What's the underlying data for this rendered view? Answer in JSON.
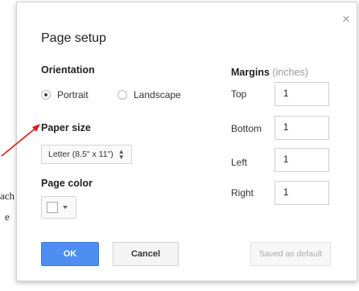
{
  "dialog": {
    "title": "Page setup",
    "close_glyph": "×"
  },
  "orientation": {
    "label": "Orientation",
    "options": [
      {
        "label": "Portrait",
        "selected": true
      },
      {
        "label": "Landscape",
        "selected": false
      }
    ]
  },
  "paper_size": {
    "label": "Paper size",
    "value": "Letter (8.5\" x 11\")"
  },
  "page_color": {
    "label": "Page color",
    "value": "#ffffff"
  },
  "margins": {
    "label": "Margins",
    "unit": "(inches)",
    "fields": [
      {
        "label": "Top",
        "value": "1"
      },
      {
        "label": "Bottom",
        "value": "1"
      },
      {
        "label": "Left",
        "value": "1"
      },
      {
        "label": "Right",
        "value": "1"
      }
    ]
  },
  "buttons": {
    "ok": "OK",
    "cancel": "Cancel",
    "default": "Saved as default"
  },
  "background": {
    "fragment_1": "ach",
    "fragment_2": "e"
  },
  "colors": {
    "accent": "#4d8ef0",
    "annotation_arrow": "#e01a1a"
  }
}
